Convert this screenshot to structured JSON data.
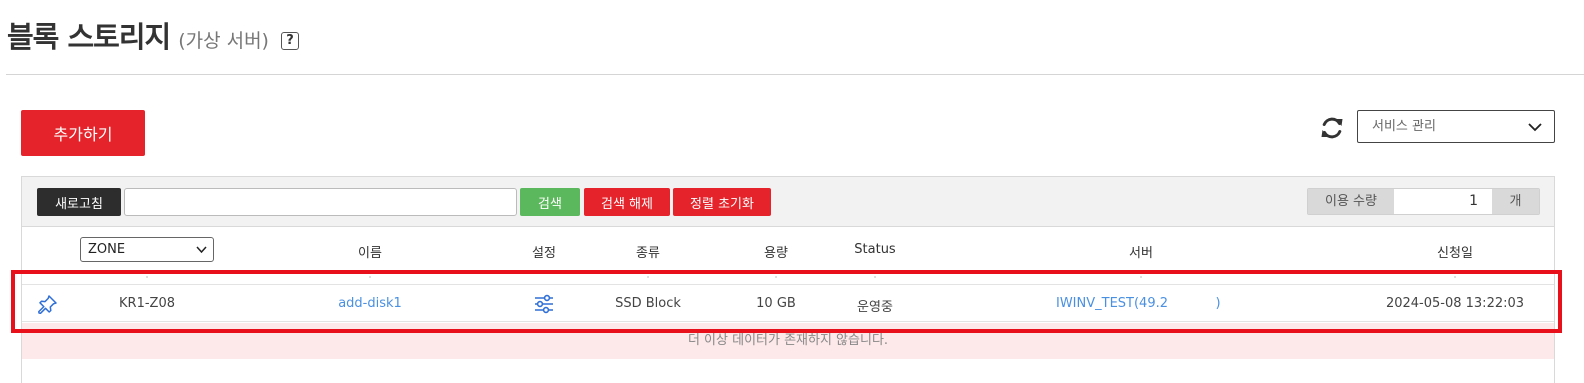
{
  "header": {
    "title": "블록 스토리지",
    "subtitle": "(가상 서버)",
    "help_label": "?"
  },
  "actions": {
    "add_label": "추가하기",
    "service_select": {
      "selected": "서비스 관리"
    }
  },
  "toolbar": {
    "refresh_label": "새로고침",
    "search_value": "",
    "search_label": "검색",
    "clear_label": "검색 해제",
    "sort_reset_label": "정렬 초기화",
    "usage_label": "이용 수량",
    "usage_value": "1",
    "usage_unit": "개"
  },
  "table": {
    "zone_filter": "ZONE",
    "columns": {
      "name": "이름",
      "settings": "설정",
      "type": "종류",
      "capacity": "용량",
      "status": "Status",
      "server": "서버",
      "date": "신청일"
    },
    "rows": [
      {
        "zone": "KR1-Z08",
        "name": "add-disk1",
        "type": "SSD Block",
        "capacity": "10 GB",
        "status": "운영중",
        "server_prefix": "IWINV_TEST(49.2",
        "server_suffix": ")",
        "date": "2024-05-08 13:22:03"
      }
    ],
    "empty_message": "더 이상 데이터가 존재하지 않습니다."
  },
  "colors": {
    "accent_red": "#e5232a",
    "search_green": "#5cb85c",
    "link_blue": "#4a90e2",
    "highlight": "#e8101b"
  },
  "icons": [
    "help-icon",
    "refresh-icon",
    "chevron-down-icon",
    "pin-icon",
    "sliders-icon"
  ]
}
